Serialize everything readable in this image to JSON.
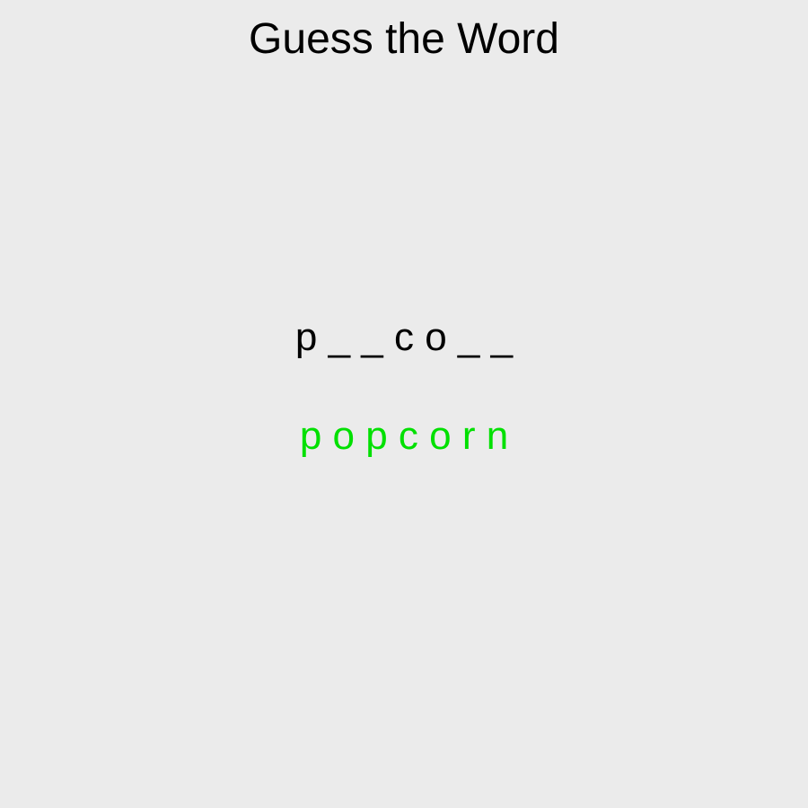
{
  "game": {
    "title": "Guess the Word",
    "masked_word": "p _ _ c o _ _",
    "revealed_word": "p o p c o r n"
  },
  "colors": {
    "background": "#ebebeb",
    "text": "#000000",
    "correct": "#00e000"
  }
}
